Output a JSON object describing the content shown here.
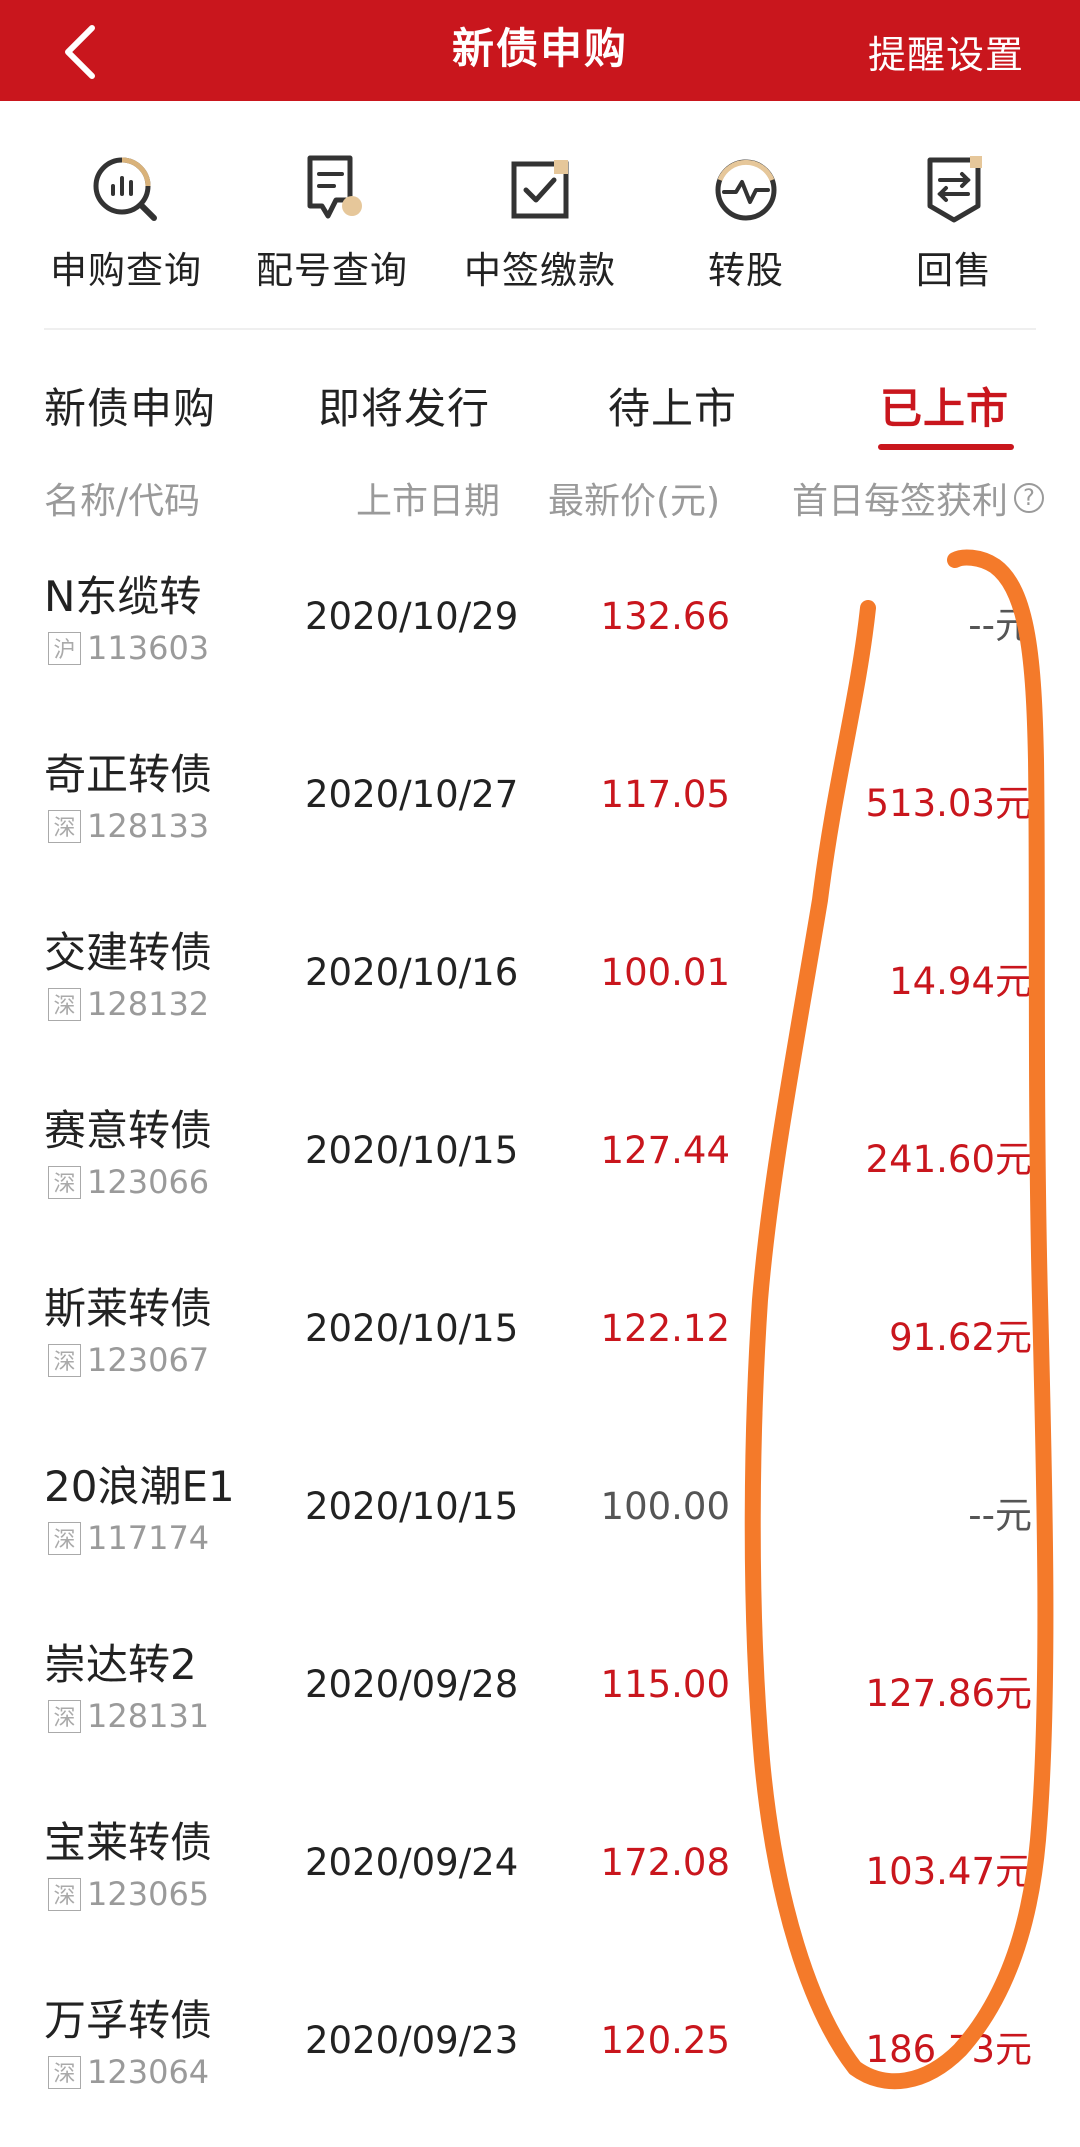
{
  "header": {
    "title": "新债申购",
    "right_action": "提醒设置"
  },
  "shortcuts": [
    {
      "label": "申购查询",
      "icon": "search-chart-icon"
    },
    {
      "label": "配号查询",
      "icon": "receipt-icon"
    },
    {
      "label": "中签缴款",
      "icon": "checkbox-icon"
    },
    {
      "label": "转股",
      "icon": "pulse-icon"
    },
    {
      "label": "回售",
      "icon": "exchange-doc-icon"
    }
  ],
  "tabs": [
    {
      "label": "新债申购"
    },
    {
      "label": "即将发行"
    },
    {
      "label": "待上市"
    },
    {
      "label": "已上市",
      "active": true
    }
  ],
  "columns": {
    "name": "名称/代码",
    "date": "上市日期",
    "price": "最新价(元)",
    "profit": "首日每签获利",
    "help": "?"
  },
  "bonds": [
    {
      "name": "N东缆转",
      "market": "沪",
      "code": "113603",
      "date": "2020/10/29",
      "price": "132.66",
      "profit": "--元",
      "price_up": true,
      "profit_up": false
    },
    {
      "name": "奇正转债",
      "market": "深",
      "code": "128133",
      "date": "2020/10/27",
      "price": "117.05",
      "profit": "513.03元",
      "price_up": true,
      "profit_up": true
    },
    {
      "name": "交建转债",
      "market": "深",
      "code": "128132",
      "date": "2020/10/16",
      "price": "100.01",
      "profit": "14.94元",
      "price_up": true,
      "profit_up": true
    },
    {
      "name": "赛意转债",
      "market": "深",
      "code": "123066",
      "date": "2020/10/15",
      "price": "127.44",
      "profit": "241.60元",
      "price_up": true,
      "profit_up": true
    },
    {
      "name": "斯莱转债",
      "market": "深",
      "code": "123067",
      "date": "2020/10/15",
      "price": "122.12",
      "profit": "91.62元",
      "price_up": true,
      "profit_up": true
    },
    {
      "name": "20浪潮E1",
      "market": "深",
      "code": "117174",
      "date": "2020/10/15",
      "price": "100.00",
      "profit": "--元",
      "price_up": false,
      "profit_up": false
    },
    {
      "name": "崇达转2",
      "market": "深",
      "code": "128131",
      "date": "2020/09/28",
      "price": "115.00",
      "profit": "127.86元",
      "price_up": true,
      "profit_up": true
    },
    {
      "name": "宝莱转债",
      "market": "深",
      "code": "123065",
      "date": "2020/09/24",
      "price": "172.08",
      "profit": "103.47元",
      "price_up": true,
      "profit_up": true
    },
    {
      "name": "万孚转债",
      "market": "深",
      "code": "123064",
      "date": "2020/09/23",
      "price": "120.25",
      "profit": "186.73元",
      "price_up": true,
      "profit_up": true
    }
  ],
  "colors": {
    "brand_red": "#c9161d",
    "annotation_orange": "#f47a2a"
  }
}
